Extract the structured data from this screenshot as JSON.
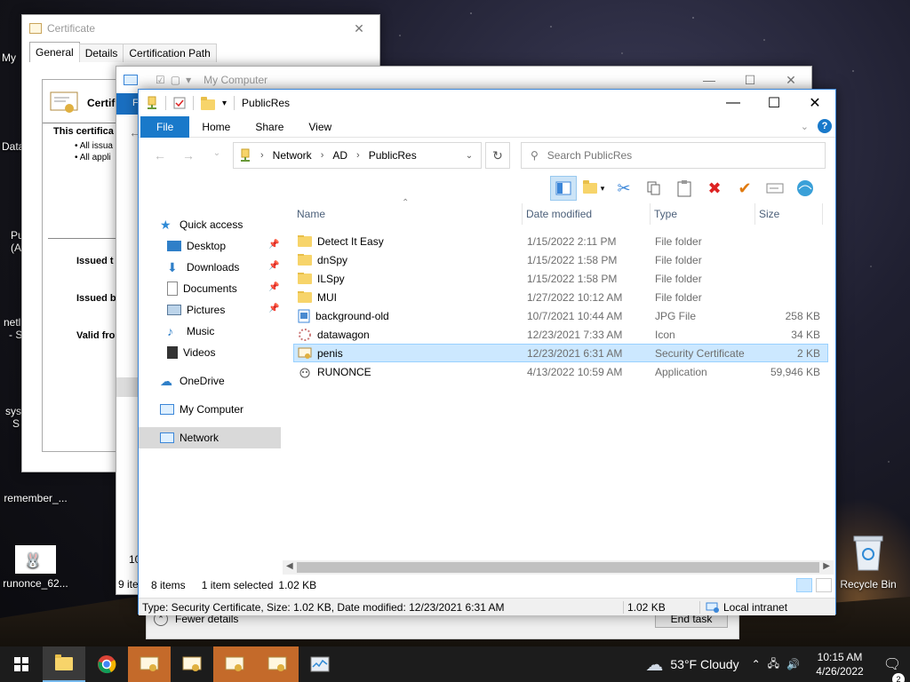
{
  "desktop": {
    "left_fragments": [
      "My",
      "Data",
      "Pu",
      "(A",
      "netl",
      "- S",
      "sys",
      "S"
    ],
    "icon_remember": "remember_...",
    "icon_runonce": "runonce_62...",
    "icon_recycle": "Recycle Bin"
  },
  "cert_window": {
    "title": "Certificate",
    "tabs": [
      "General",
      "Details",
      "Certification Path"
    ],
    "heading": "Certifi",
    "intended_label": "This certifica",
    "bullets": [
      "• All issua",
      "• All appli"
    ],
    "issued_to": "Issued t",
    "issued_by": "Issued b",
    "valid_from": "Valid fro"
  },
  "mycomp_window": {
    "title": "My Computer",
    "ribbon_file": "Fi",
    "status_count": "9 ite",
    "status_upper": "10"
  },
  "taskmgr": {
    "fewer_details": "Fewer details",
    "end_task": "End task"
  },
  "explorer": {
    "title": "PublicRes",
    "ribbon_tabs": {
      "file": "File",
      "home": "Home",
      "share": "Share",
      "view": "View"
    },
    "breadcrumb": [
      "Network",
      "AD",
      "PublicRes"
    ],
    "search_placeholder": "Search PublicRes",
    "nav": {
      "quick_access": "Quick access",
      "desktop": "Desktop",
      "downloads": "Downloads",
      "documents": "Documents",
      "pictures": "Pictures",
      "music": "Music",
      "videos": "Videos",
      "onedrive": "OneDrive",
      "my_computer": "My Computer",
      "network": "Network"
    },
    "columns": {
      "name": "Name",
      "date": "Date modified",
      "type": "Type",
      "size": "Size"
    },
    "files": [
      {
        "name": "Detect It Easy",
        "date": "1/15/2022 2:11 PM",
        "type": "File folder",
        "size": ""
      },
      {
        "name": "dnSpy",
        "date": "1/15/2022 1:58 PM",
        "type": "File folder",
        "size": ""
      },
      {
        "name": "ILSpy",
        "date": "1/15/2022 1:58 PM",
        "type": "File folder",
        "size": ""
      },
      {
        "name": "MUI",
        "date": "1/27/2022 10:12 AM",
        "type": "File folder",
        "size": ""
      },
      {
        "name": "background-old",
        "date": "10/7/2021 10:44 AM",
        "type": "JPG File",
        "size": "258 KB"
      },
      {
        "name": "datawagon",
        "date": "12/23/2021 7:33 AM",
        "type": "Icon",
        "size": "34 KB"
      },
      {
        "name": "penis",
        "date": "12/23/2021 6:31 AM",
        "type": "Security Certificate",
        "size": "2 KB"
      },
      {
        "name": "RUNONCE",
        "date": "4/13/2022 10:59 AM",
        "type": "Application",
        "size": "59,946 KB"
      }
    ],
    "status_items": "8 items",
    "status_selected": "1 item selected",
    "status_size": "1.02 KB",
    "info_text": "Type: Security Certificate, Size: 1.02 KB, Date modified: 12/23/2021 6:31 AM",
    "info_size": "1.02 KB",
    "info_zone": "Local intranet"
  },
  "taskbar": {
    "weather": "53°F  Cloudy",
    "time": "10:15 AM",
    "date": "4/26/2022",
    "notif_count": "2"
  },
  "colors": {
    "accent": "#1979ca",
    "selection": "#cce8ff",
    "folder": "#f7d46a",
    "taskbar": "#1c1c1c"
  }
}
